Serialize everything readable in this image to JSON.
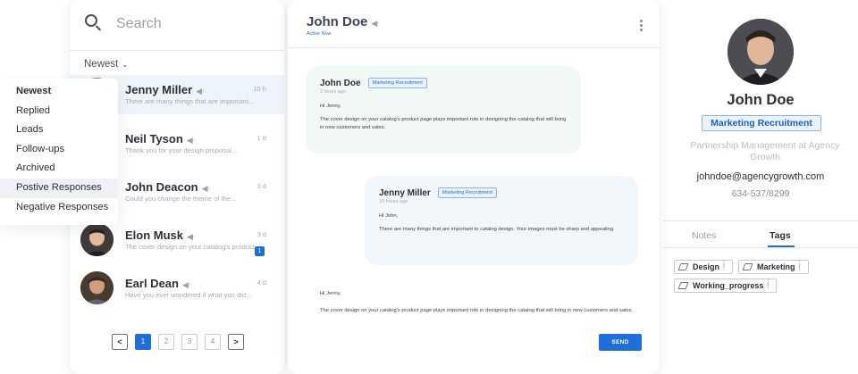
{
  "filters": {
    "items": [
      {
        "label": "Newest",
        "bold": true,
        "active": false
      },
      {
        "label": "Replied",
        "bold": false,
        "active": false
      },
      {
        "label": "Leads",
        "bold": false,
        "active": false
      },
      {
        "label": "Follow-ups",
        "bold": false,
        "active": false
      },
      {
        "label": "Archived",
        "bold": false,
        "active": false
      },
      {
        "label": "Postive Responses",
        "bold": false,
        "active": true
      },
      {
        "label": "Negative Responses",
        "bold": false,
        "active": false
      }
    ]
  },
  "list": {
    "search_placeholder": "Search",
    "sort_label": "Newest",
    "conversations": [
      {
        "name": "Jenny Miller",
        "preview": "There are many things that are important...",
        "time": "10 h",
        "unread": "",
        "active": true
      },
      {
        "name": "Neil Tyson",
        "preview": "Thank you for your design proposal...",
        "time": "1 d",
        "unread": "",
        "active": false
      },
      {
        "name": "John Deacon",
        "preview": "Could you change the theme of the...",
        "time": "3 d",
        "unread": "",
        "active": false
      },
      {
        "name": "Elon Musk",
        "preview": "The cover design on your catalog's product...",
        "time": "3 d",
        "unread": "1",
        "active": false
      },
      {
        "name": "Earl Dean",
        "preview": "Have you ever wondered if what you did...",
        "time": "4 d",
        "unread": "",
        "active": false
      }
    ],
    "pagination": {
      "prev": "<",
      "pages": [
        "1",
        "2",
        "3",
        "4"
      ],
      "current": "1",
      "next": ">"
    }
  },
  "chat": {
    "title": "John Doe",
    "status": "Active Now",
    "messages": [
      {
        "sender": "John Doe",
        "tag": "Marketing Recruitment",
        "time": "2 hours ago",
        "greeting": "Hi Jenny,",
        "body": "The cover design on your catalog's product page plays important role in designing the catalog that will bring in new customers and sales."
      },
      {
        "sender": "Jenny Miller",
        "tag": "Marketing Recruitment",
        "time": "10 hours ago",
        "greeting": "Hi John,",
        "body": "There are many things that are important to catalog design. Your images must be sharp and appealing."
      }
    ],
    "compose": {
      "greeting": "Hi Jenny,",
      "body": "The cover design on your catalog's product page plays important role in designing the catalog that will bring in new customers and sales."
    },
    "send_label": "SEND"
  },
  "profile": {
    "name": "John Doe",
    "tag": "Marketing Recruitment",
    "role": "Partnership Management at Agency Growth",
    "email": "johndoe@agencygrowth.com",
    "phone": "634-537/8299",
    "tabs": [
      "Notes",
      "Tags"
    ],
    "active_tab": "Tags",
    "tags": [
      "Design",
      "Marketing",
      "Working_progress"
    ]
  },
  "colors": {
    "accent": "#1e6fd9",
    "active_row": "#eef4fb",
    "bubble_green": "#f2f8f3",
    "bubble_blue": "#f2f7fb"
  },
  "icons": [
    "search-icon",
    "chevron-down-icon",
    "sound-icon",
    "more-vertical-icon",
    "tag-icon",
    "drag-handle-icon"
  ]
}
